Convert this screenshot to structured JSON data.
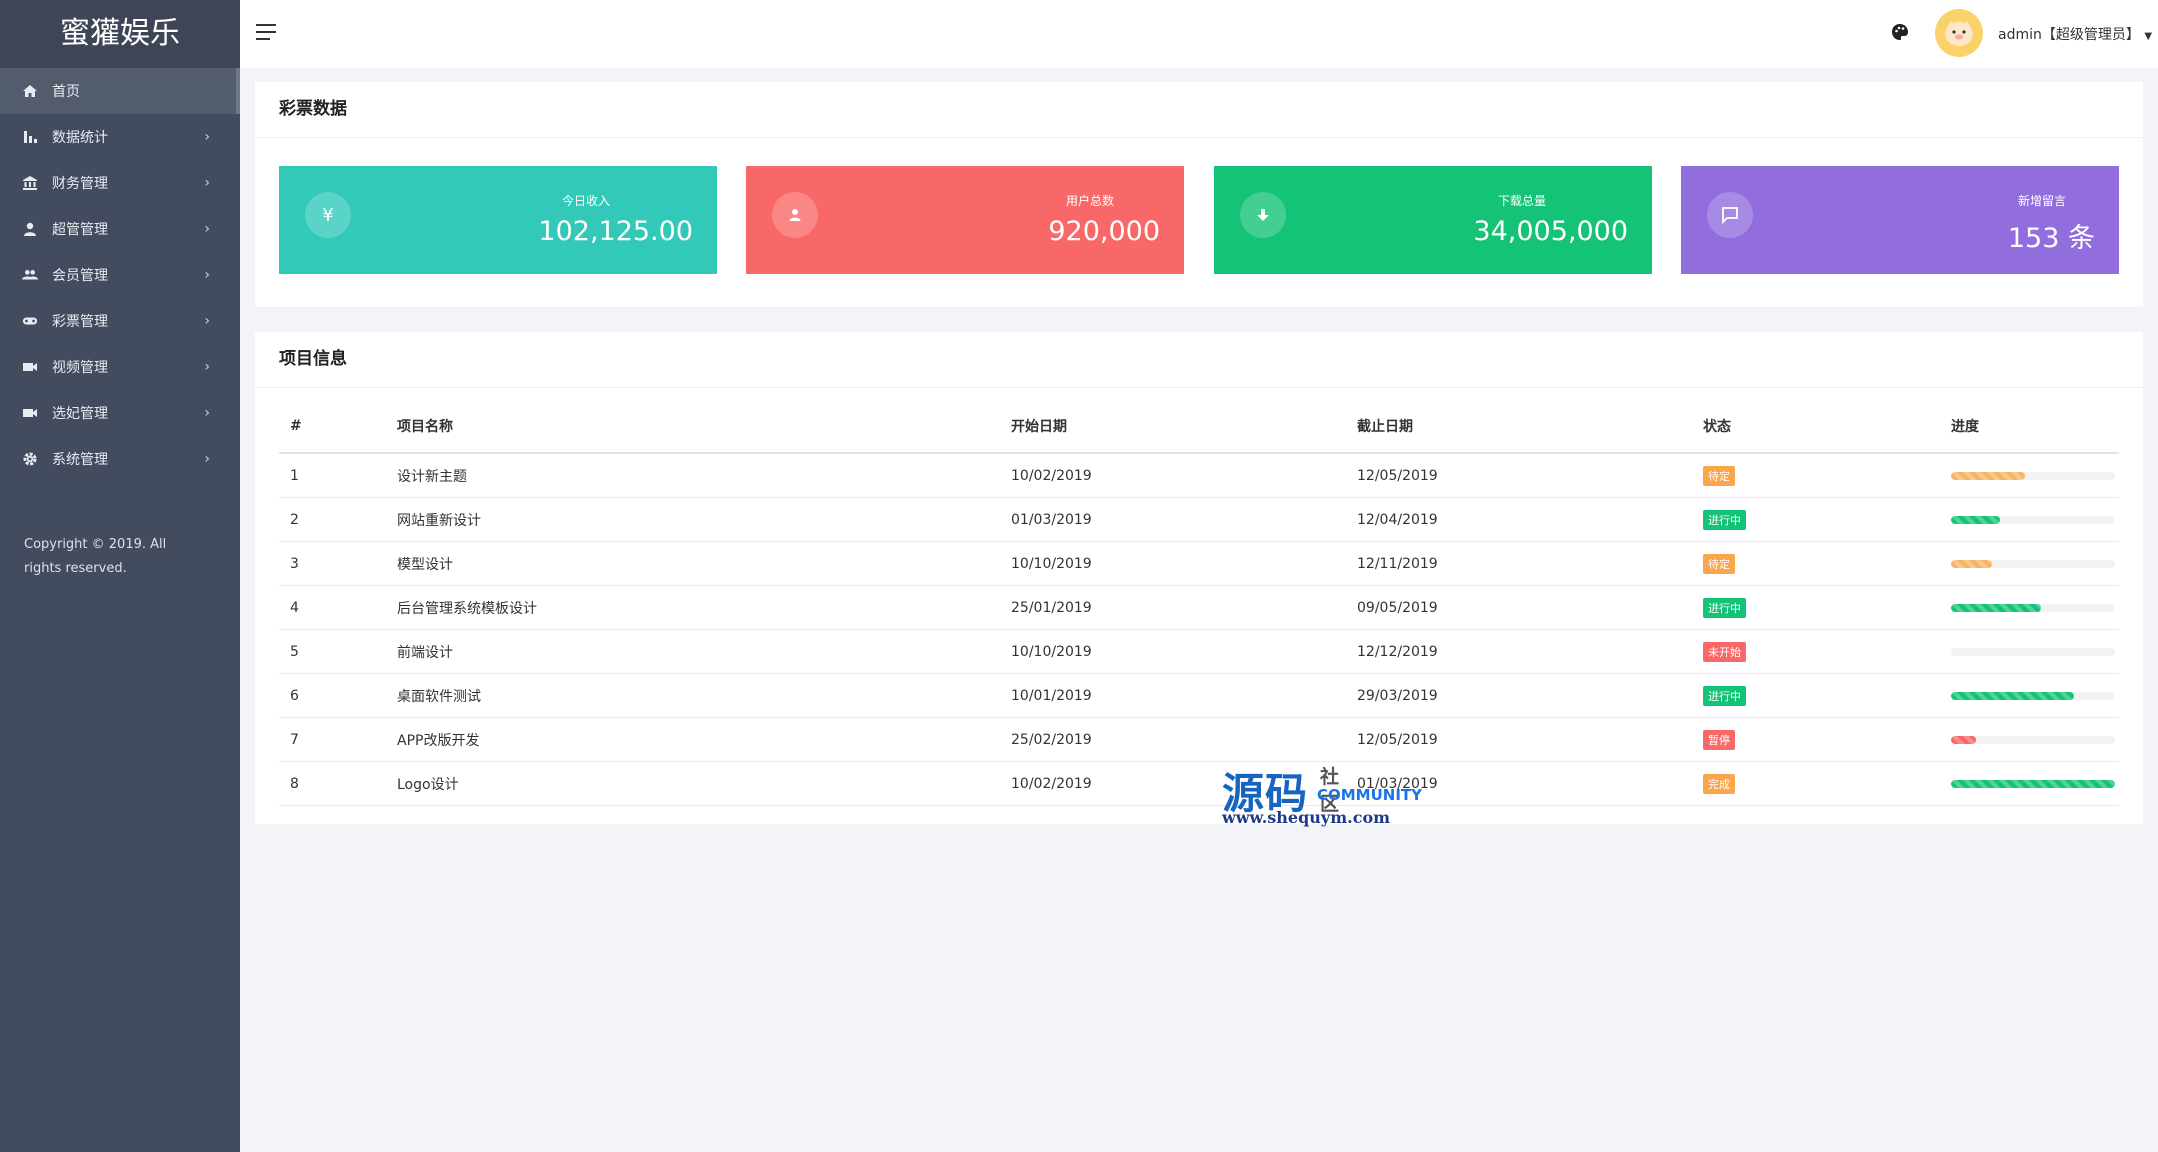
{
  "app": {
    "title": "蜜獾娱乐"
  },
  "sidebar": {
    "items": [
      {
        "label": "首页",
        "icon": "home-icon",
        "active": true
      },
      {
        "label": "数据统计",
        "icon": "bar-chart-icon"
      },
      {
        "label": "财务管理",
        "icon": "bank-icon"
      },
      {
        "label": "超管管理",
        "icon": "person-icon"
      },
      {
        "label": "会员管理",
        "icon": "group-icon"
      },
      {
        "label": "彩票管理",
        "icon": "gamepad-icon"
      },
      {
        "label": "视频管理",
        "icon": "video-icon"
      },
      {
        "label": "选妃管理",
        "icon": "video-icon"
      },
      {
        "label": "系统管理",
        "icon": "gear-icon"
      }
    ],
    "copyright": "Copyright © 2019. All rights reserved."
  },
  "header": {
    "user_label": "admin【超级管理员】",
    "icons": [
      "menu-icon",
      "palette-icon",
      "avatar"
    ]
  },
  "stats": {
    "title": "彩票数据",
    "cards": [
      {
        "label": "今日收入",
        "value": "102,125.00",
        "icon": "yen-icon",
        "color": "#33c9b8",
        "circle": "#5ad4c7"
      },
      {
        "label": "用户总数",
        "value": "920,000",
        "icon": "user-icon",
        "color": "#f96868",
        "circle": "#fa8686"
      },
      {
        "label": "下载总量",
        "value": "34,005,000",
        "icon": "download-icon",
        "color": "#15c377",
        "circle": "#43cf91"
      },
      {
        "label": "新增留言",
        "value": "153 条",
        "icon": "message-icon",
        "color": "#926dde",
        "circle": "#a78ae4"
      }
    ]
  },
  "projects": {
    "title": "项目信息",
    "columns": [
      "#",
      "项目名称",
      "开始日期",
      "截止日期",
      "状态",
      "进度"
    ],
    "rows": [
      {
        "id": "1",
        "name": "设计新主题",
        "start": "10/02/2019",
        "end": "12/05/2019",
        "status": "待定",
        "status_color": "#faa64b",
        "progress": 45,
        "bar_color": "#f7b462"
      },
      {
        "id": "2",
        "name": "网站重新设计",
        "start": "01/03/2019",
        "end": "12/04/2019",
        "status": "进行中",
        "status_color": "#15c377",
        "progress": 30,
        "bar_color": "#15c377"
      },
      {
        "id": "3",
        "name": "模型设计",
        "start": "10/10/2019",
        "end": "12/11/2019",
        "status": "待定",
        "status_color": "#faa64b",
        "progress": 25,
        "bar_color": "#f7b462"
      },
      {
        "id": "4",
        "name": "后台管理系统模板设计",
        "start": "25/01/2019",
        "end": "09/05/2019",
        "status": "进行中",
        "status_color": "#15c377",
        "progress": 55,
        "bar_color": "#15c377"
      },
      {
        "id": "5",
        "name": "前端设计",
        "start": "10/10/2019",
        "end": "12/12/2019",
        "status": "未开始",
        "status_color": "#f96868",
        "progress": 0,
        "bar_color": "#f96868"
      },
      {
        "id": "6",
        "name": "桌面软件测试",
        "start": "10/01/2019",
        "end": "29/03/2019",
        "status": "进行中",
        "status_color": "#15c377",
        "progress": 75,
        "bar_color": "#15c377"
      },
      {
        "id": "7",
        "name": "APP改版开发",
        "start": "25/02/2019",
        "end": "12/05/2019",
        "status": "暂停",
        "status_color": "#f96868",
        "progress": 15,
        "bar_color": "#f96868"
      },
      {
        "id": "8",
        "name": "Logo设计",
        "start": "10/02/2019",
        "end": "01/03/2019",
        "status": "完成",
        "status_color": "#faa64b",
        "progress": 100,
        "bar_color": "#15c377"
      }
    ]
  },
  "watermark": {
    "big": "源码",
    "small1": "社区",
    "small2": "COMMUNITY",
    "url": "www.shequym.com"
  }
}
